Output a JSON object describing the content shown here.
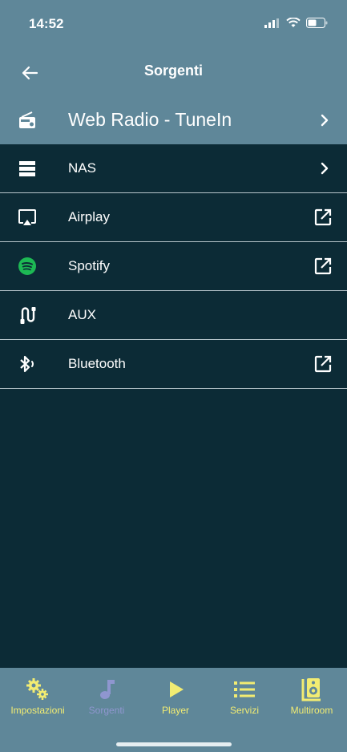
{
  "status_bar": {
    "time": "14:52"
  },
  "header": {
    "title": "Sorgenti"
  },
  "sources": [
    {
      "label": "Web Radio - TuneIn",
      "icon": "radio-icon",
      "action": "chevron"
    },
    {
      "label": "NAS",
      "icon": "nas-icon",
      "action": "chevron"
    },
    {
      "label": "Airplay",
      "icon": "airplay-icon",
      "action": "external"
    },
    {
      "label": "Spotify",
      "icon": "spotify-icon",
      "action": "external"
    },
    {
      "label": "AUX",
      "icon": "aux-cable-icon",
      "action": "none"
    },
    {
      "label": "Bluetooth",
      "icon": "bluetooth-icon",
      "action": "external"
    }
  ],
  "tabs": [
    {
      "label": "Impostazioni",
      "icon": "gears-icon",
      "active": true
    },
    {
      "label": "Sorgenti",
      "icon": "music-note-icon",
      "active": false
    },
    {
      "label": "Player",
      "icon": "play-icon",
      "active": true
    },
    {
      "label": "Servizi",
      "icon": "list-icon",
      "active": true
    },
    {
      "label": "Multiroom",
      "icon": "speaker-icon",
      "active": true
    }
  ],
  "colors": {
    "background": "#0c2b36",
    "header": "#5f8799",
    "tab_accent": "#f2ec72",
    "tab_inactive": "#8f96cf",
    "spotify": "#1db954"
  }
}
